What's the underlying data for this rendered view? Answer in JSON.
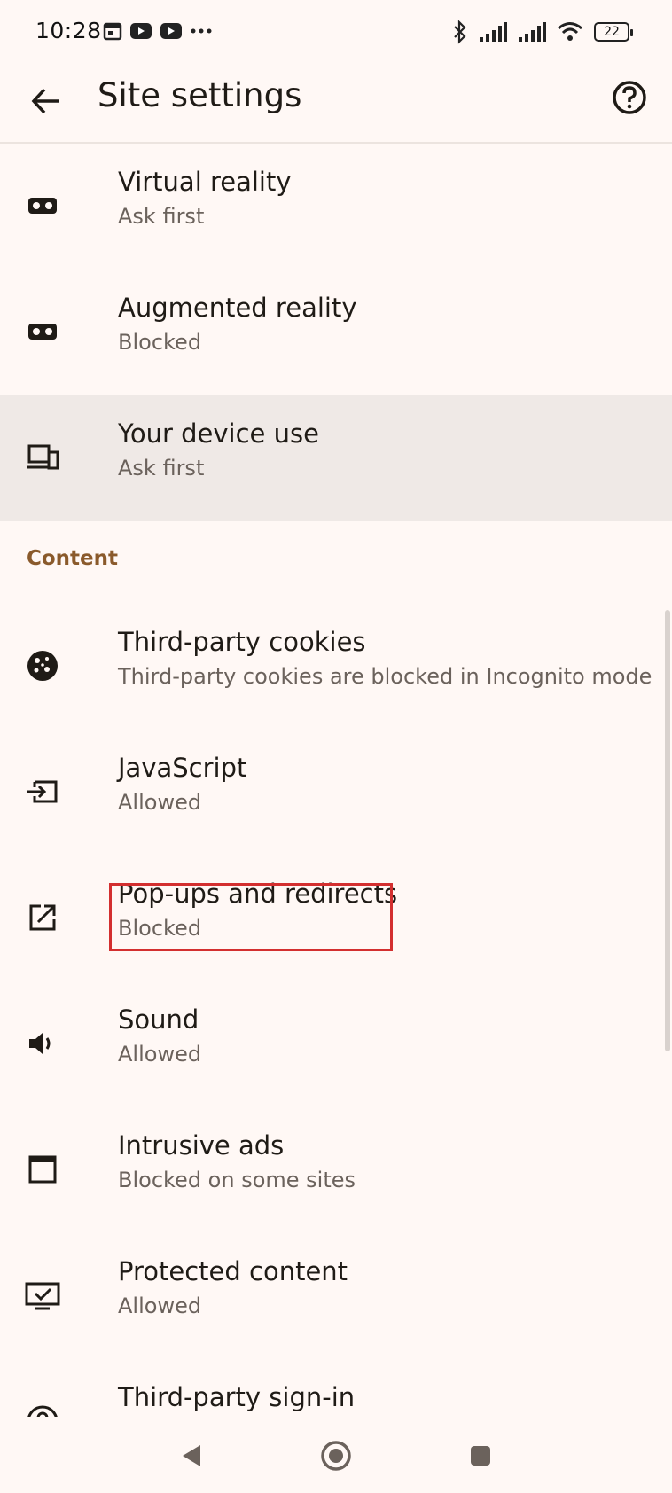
{
  "status_bar": {
    "time": "10:28",
    "left_icons": [
      "calendar-icon",
      "youtube-icon",
      "youtube-icon",
      "more-dots-icon"
    ],
    "right_icons": [
      "bluetooth-icon",
      "signal-icon",
      "signal-icon",
      "wifi-icon",
      "battery-icon"
    ],
    "battery": "22"
  },
  "app_bar": {
    "title": "Site settings",
    "back_icon": "arrow-back-icon",
    "help_icon": "help-icon"
  },
  "items_top": [
    {
      "title": "Virtual reality",
      "subtitle": "Ask first",
      "icon": "vr-headset-icon"
    },
    {
      "title": "Augmented reality",
      "subtitle": "Blocked",
      "icon": "ar-headset-icon"
    },
    {
      "title": "Your device use",
      "subtitle": "Ask first",
      "icon": "devices-icon"
    }
  ],
  "section_content": "Content",
  "items_content": [
    {
      "title": "Third-party cookies",
      "subtitle": "Third-party cookies are blocked in Incognito mode",
      "icon": "cookie-icon"
    },
    {
      "title": "JavaScript",
      "subtitle": "Allowed",
      "icon": "javascript-icon"
    },
    {
      "title": "Pop-ups and redirects",
      "subtitle": "Blocked",
      "icon": "open-in-new-icon"
    },
    {
      "title": "Sound",
      "subtitle": "Allowed",
      "icon": "volume-icon"
    },
    {
      "title": "Intrusive ads",
      "subtitle": "Blocked on some sites",
      "icon": "ads-window-icon"
    },
    {
      "title": "Protected content",
      "subtitle": "Allowed",
      "icon": "protected-content-icon"
    },
    {
      "title": "Third-party sign-in",
      "subtitle": "",
      "icon": "sign-in-icon"
    }
  ],
  "nav_bar": [
    "back-triangle-icon",
    "home-circle-icon",
    "recents-square-icon"
  ]
}
